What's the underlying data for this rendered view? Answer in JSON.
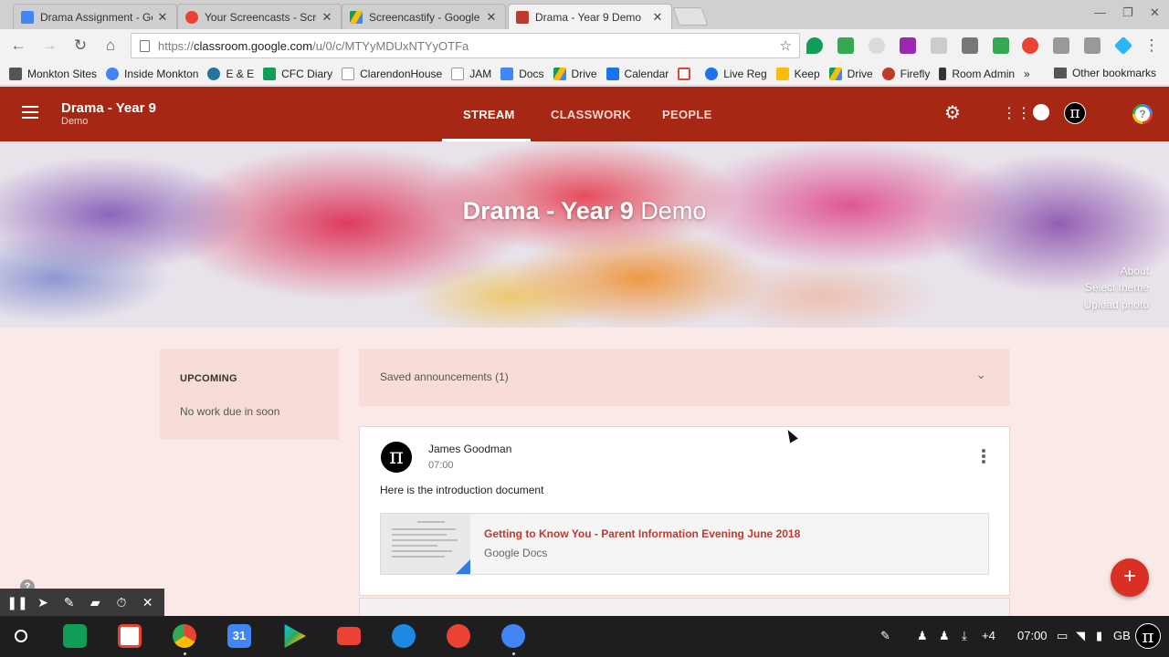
{
  "browser": {
    "tabs": [
      {
        "title": "Drama Assignment - Goo",
        "favicon_color": "#4285f4"
      },
      {
        "title": "Your Screencasts - Scree",
        "favicon_color": "#ea4335"
      },
      {
        "title": "Screencastify - Google D",
        "favicon_color": "#34a853"
      },
      {
        "title": "Drama - Year 9 Demo",
        "favicon_color": "#c0392b"
      }
    ],
    "tab_close": "✕",
    "url_prefix": "https://",
    "url_host": "classroom.google.com",
    "url_path": "/u/0/c/MTYyMDUxNTYyOTFa"
  },
  "bookmarks": [
    {
      "label": "Monkton Sites",
      "color": "#555"
    },
    {
      "label": "Inside Monkton",
      "color": "#4285f4"
    },
    {
      "label": "E & E",
      "color": "#21759b"
    },
    {
      "label": "CFC Diary",
      "color": "#0f9d58"
    },
    {
      "label": "ClarendonHouse",
      "color": "#999"
    },
    {
      "label": "JAM",
      "color": "#999"
    },
    {
      "label": "Docs",
      "color": "#4285f4"
    },
    {
      "label": "Drive",
      "color": "#fbbc05"
    },
    {
      "label": "Calendar",
      "color": "#1a73e8"
    },
    {
      "label": "",
      "color": "#ea4335"
    },
    {
      "label": "Live Reg",
      "color": "#1a73e8"
    },
    {
      "label": "Keep",
      "color": "#fbbc05"
    },
    {
      "label": "Drive",
      "color": "#0f9d58"
    },
    {
      "label": "Firefly",
      "color": "#c0392b"
    },
    {
      "label": "Room Admin",
      "color": "#333"
    }
  ],
  "bookmarks_overflow": "»",
  "bookmarks_other": "Other bookmarks",
  "classroom": {
    "title": "Drama - Year 9",
    "subtitle": "Demo",
    "tabs": [
      "STREAM",
      "CLASSWORK",
      "PEOPLE"
    ],
    "banner_title_bold": "Drama - Year 9",
    "banner_title_light": "Demo",
    "banner_links": [
      "About",
      "Select theme",
      "Upload photo"
    ],
    "brand_color": "#a52714"
  },
  "upcoming": {
    "heading": "UPCOMING",
    "text": "No work due in soon"
  },
  "saved_announcements": "Saved announcements (1)",
  "post": {
    "author": "James Goodman",
    "time": "07:00",
    "body": "Here is the introduction document",
    "attachment_title": "Getting to Know You - Parent Information Evening June 2018",
    "attachment_source": "Google Docs"
  },
  "fab_label": "+",
  "shelf": {
    "apps": [
      "classroom-icon",
      "gmail-icon",
      "chrome-icon",
      "calendar-icon",
      "play-store-icon",
      "youtube-icon",
      "files-icon",
      "photos-icon",
      "settings-icon"
    ],
    "calendar_day": "31",
    "tray_count": "+4",
    "clock": "07:00",
    "locale": "GB"
  }
}
